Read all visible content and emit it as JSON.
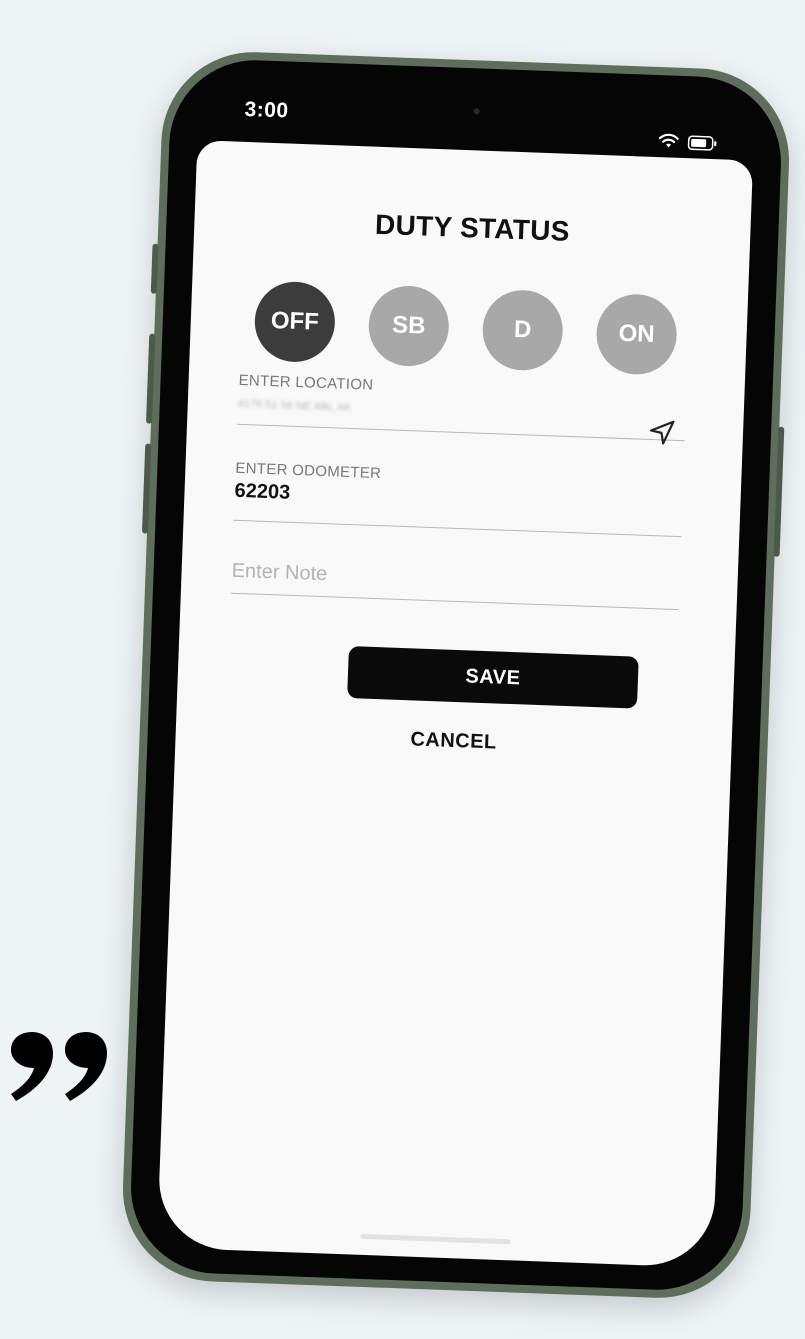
{
  "status_bar": {
    "time": "3:00",
    "icons": [
      "wifi-icon",
      "battery-icon"
    ]
  },
  "screen": {
    "title": "DUTY STATUS",
    "duty_statuses": [
      {
        "label": "OFF",
        "selected": true
      },
      {
        "label": "SB",
        "selected": false
      },
      {
        "label": "D",
        "selected": false
      },
      {
        "label": "ON",
        "selected": false
      }
    ],
    "location": {
      "label": "ENTER LOCATION",
      "value": "4176 51 56 NE Alki, AK",
      "icon": "navigation-arrow-icon"
    },
    "odometer": {
      "label": "ENTER ODOMETER",
      "value": "62203"
    },
    "note": {
      "placeholder": "Enter Note",
      "value": ""
    },
    "save_label": "SAVE",
    "cancel_label": "CANCEL"
  },
  "colors": {
    "selected_status": "#3c3c3c",
    "unselected_status": "#a8a8a8",
    "primary_button": "#0a0a0a",
    "phone_frame": "#5f6e5c",
    "page_background": "#eef3f6"
  }
}
